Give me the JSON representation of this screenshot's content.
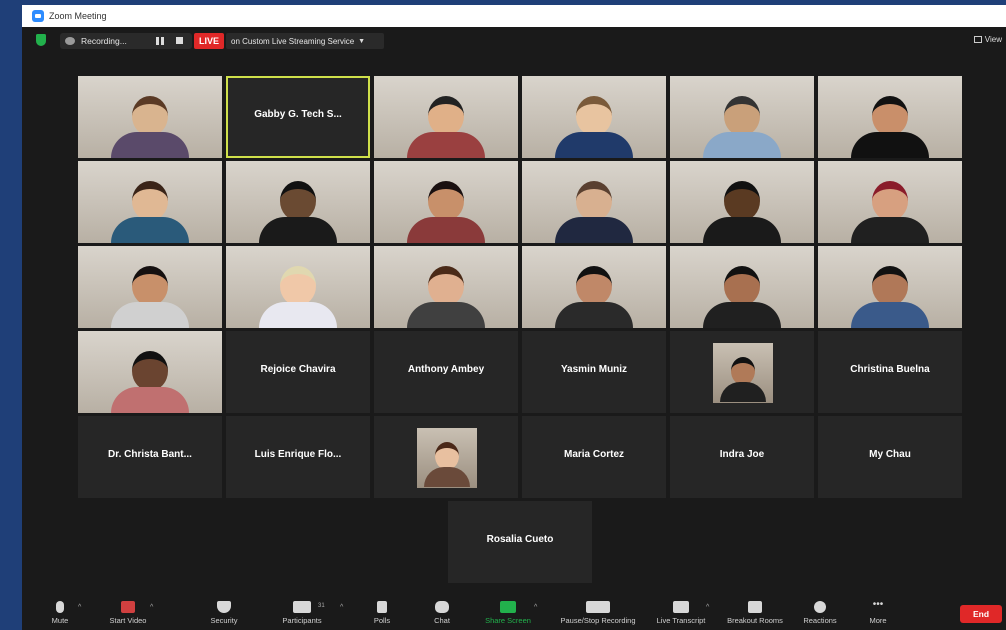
{
  "window": {
    "title": "Zoom Meeting"
  },
  "meeting_bar": {
    "recording_label": "Recording...",
    "live_badge": "LIVE",
    "stream_label": "on Custom Live Streaming Service",
    "view_label": "View"
  },
  "participants": [
    {
      "type": "video",
      "skin": "#d9b48f",
      "shirt": "#5a4a6a",
      "hair": "#5a3a25"
    },
    {
      "type": "name",
      "name": "Gabby G. Tech S..."
    },
    {
      "type": "video",
      "skin": "#e0b088",
      "shirt": "#9a4040",
      "hair": "#222222"
    },
    {
      "type": "video",
      "skin": "#e8c4a0",
      "shirt": "#203a6a",
      "hair": "#7a5a3a"
    },
    {
      "type": "video",
      "skin": "#c9a07a",
      "shirt": "#8aa8c8",
      "hair": "#333333"
    },
    {
      "type": "video",
      "skin": "#c98f6a",
      "shirt": "#111111",
      "hair": "#111111"
    },
    {
      "type": "video",
      "skin": "#e0b894",
      "shirt": "#2a5a7a",
      "hair": "#3a2418"
    },
    {
      "type": "video",
      "skin": "#6a4a32",
      "shirt": "#1a1a1a",
      "hair": "#111111"
    },
    {
      "type": "video",
      "skin": "#c8906a",
      "shirt": "#8a3a3a",
      "hair": "#1a1010"
    },
    {
      "type": "video",
      "skin": "#d8b090",
      "shirt": "#202840",
      "hair": "#5a4030"
    },
    {
      "type": "video",
      "skin": "#5a3a22",
      "shirt": "#1a1a1a",
      "hair": "#111111"
    },
    {
      "type": "video",
      "skin": "#d7a080",
      "shirt": "#202020",
      "hair": "#8a1c2a"
    },
    {
      "type": "video",
      "skin": "#c8906a",
      "shirt": "#d0d0d0",
      "hair": "#151010"
    },
    {
      "type": "video",
      "skin": "#f0c8a8",
      "shirt": "#e8e8f0",
      "hair": "#e0d8b0"
    },
    {
      "type": "video",
      "skin": "#e0b090",
      "shirt": "#404040",
      "hair": "#4a2a18"
    },
    {
      "type": "video",
      "skin": "#c08868",
      "shirt": "#2a2a2a",
      "hair": "#111111"
    },
    {
      "type": "video",
      "skin": "#a87050",
      "shirt": "#202020",
      "hair": "#111111"
    },
    {
      "type": "video",
      "skin": "#b07858",
      "shirt": "#3a5a8a",
      "hair": "#111111"
    },
    {
      "type": "video",
      "skin": "#6a4430",
      "shirt": "#c07070",
      "hair": "#111111"
    },
    {
      "type": "name",
      "name": "Rejoice Chavira"
    },
    {
      "type": "name",
      "name": "Anthony Ambey"
    },
    {
      "type": "name",
      "name": "Yasmin Muniz"
    },
    {
      "type": "thumb",
      "skin": "#b07a58",
      "shirt": "#202020",
      "hair": "#111111"
    },
    {
      "type": "name",
      "name": "Christina Buelna"
    },
    {
      "type": "name",
      "name": "Dr. Christa Bant..."
    },
    {
      "type": "name",
      "name": "Luis Enrique Flo..."
    },
    {
      "type": "thumb",
      "skin": "#e8c0a0",
      "shirt": "#6a4a3a",
      "hair": "#4a2818"
    },
    {
      "type": "name",
      "name": "Maria Cortez"
    },
    {
      "type": "name",
      "name": "Indra Joe"
    },
    {
      "type": "name",
      "name": "My Chau"
    },
    {
      "type": "name",
      "name": "Rosalia Cueto"
    }
  ],
  "toolbar": {
    "mute": "Mute",
    "start_video": "Start Video",
    "security": "Security",
    "participants": "Participants",
    "participants_count": "31",
    "polls": "Polls",
    "chat": "Chat",
    "share_screen": "Share Screen",
    "pause_stop_recording": "Pause/Stop Recording",
    "live_transcript": "Live Transcript",
    "breakout_rooms": "Breakout Rooms",
    "reactions": "Reactions",
    "more": "More",
    "end": "End"
  },
  "colors": {
    "accent_green": "#22b14c",
    "live_red": "#e02828",
    "active_speaker": "#cfe04a",
    "share_green": "#22b14c"
  }
}
